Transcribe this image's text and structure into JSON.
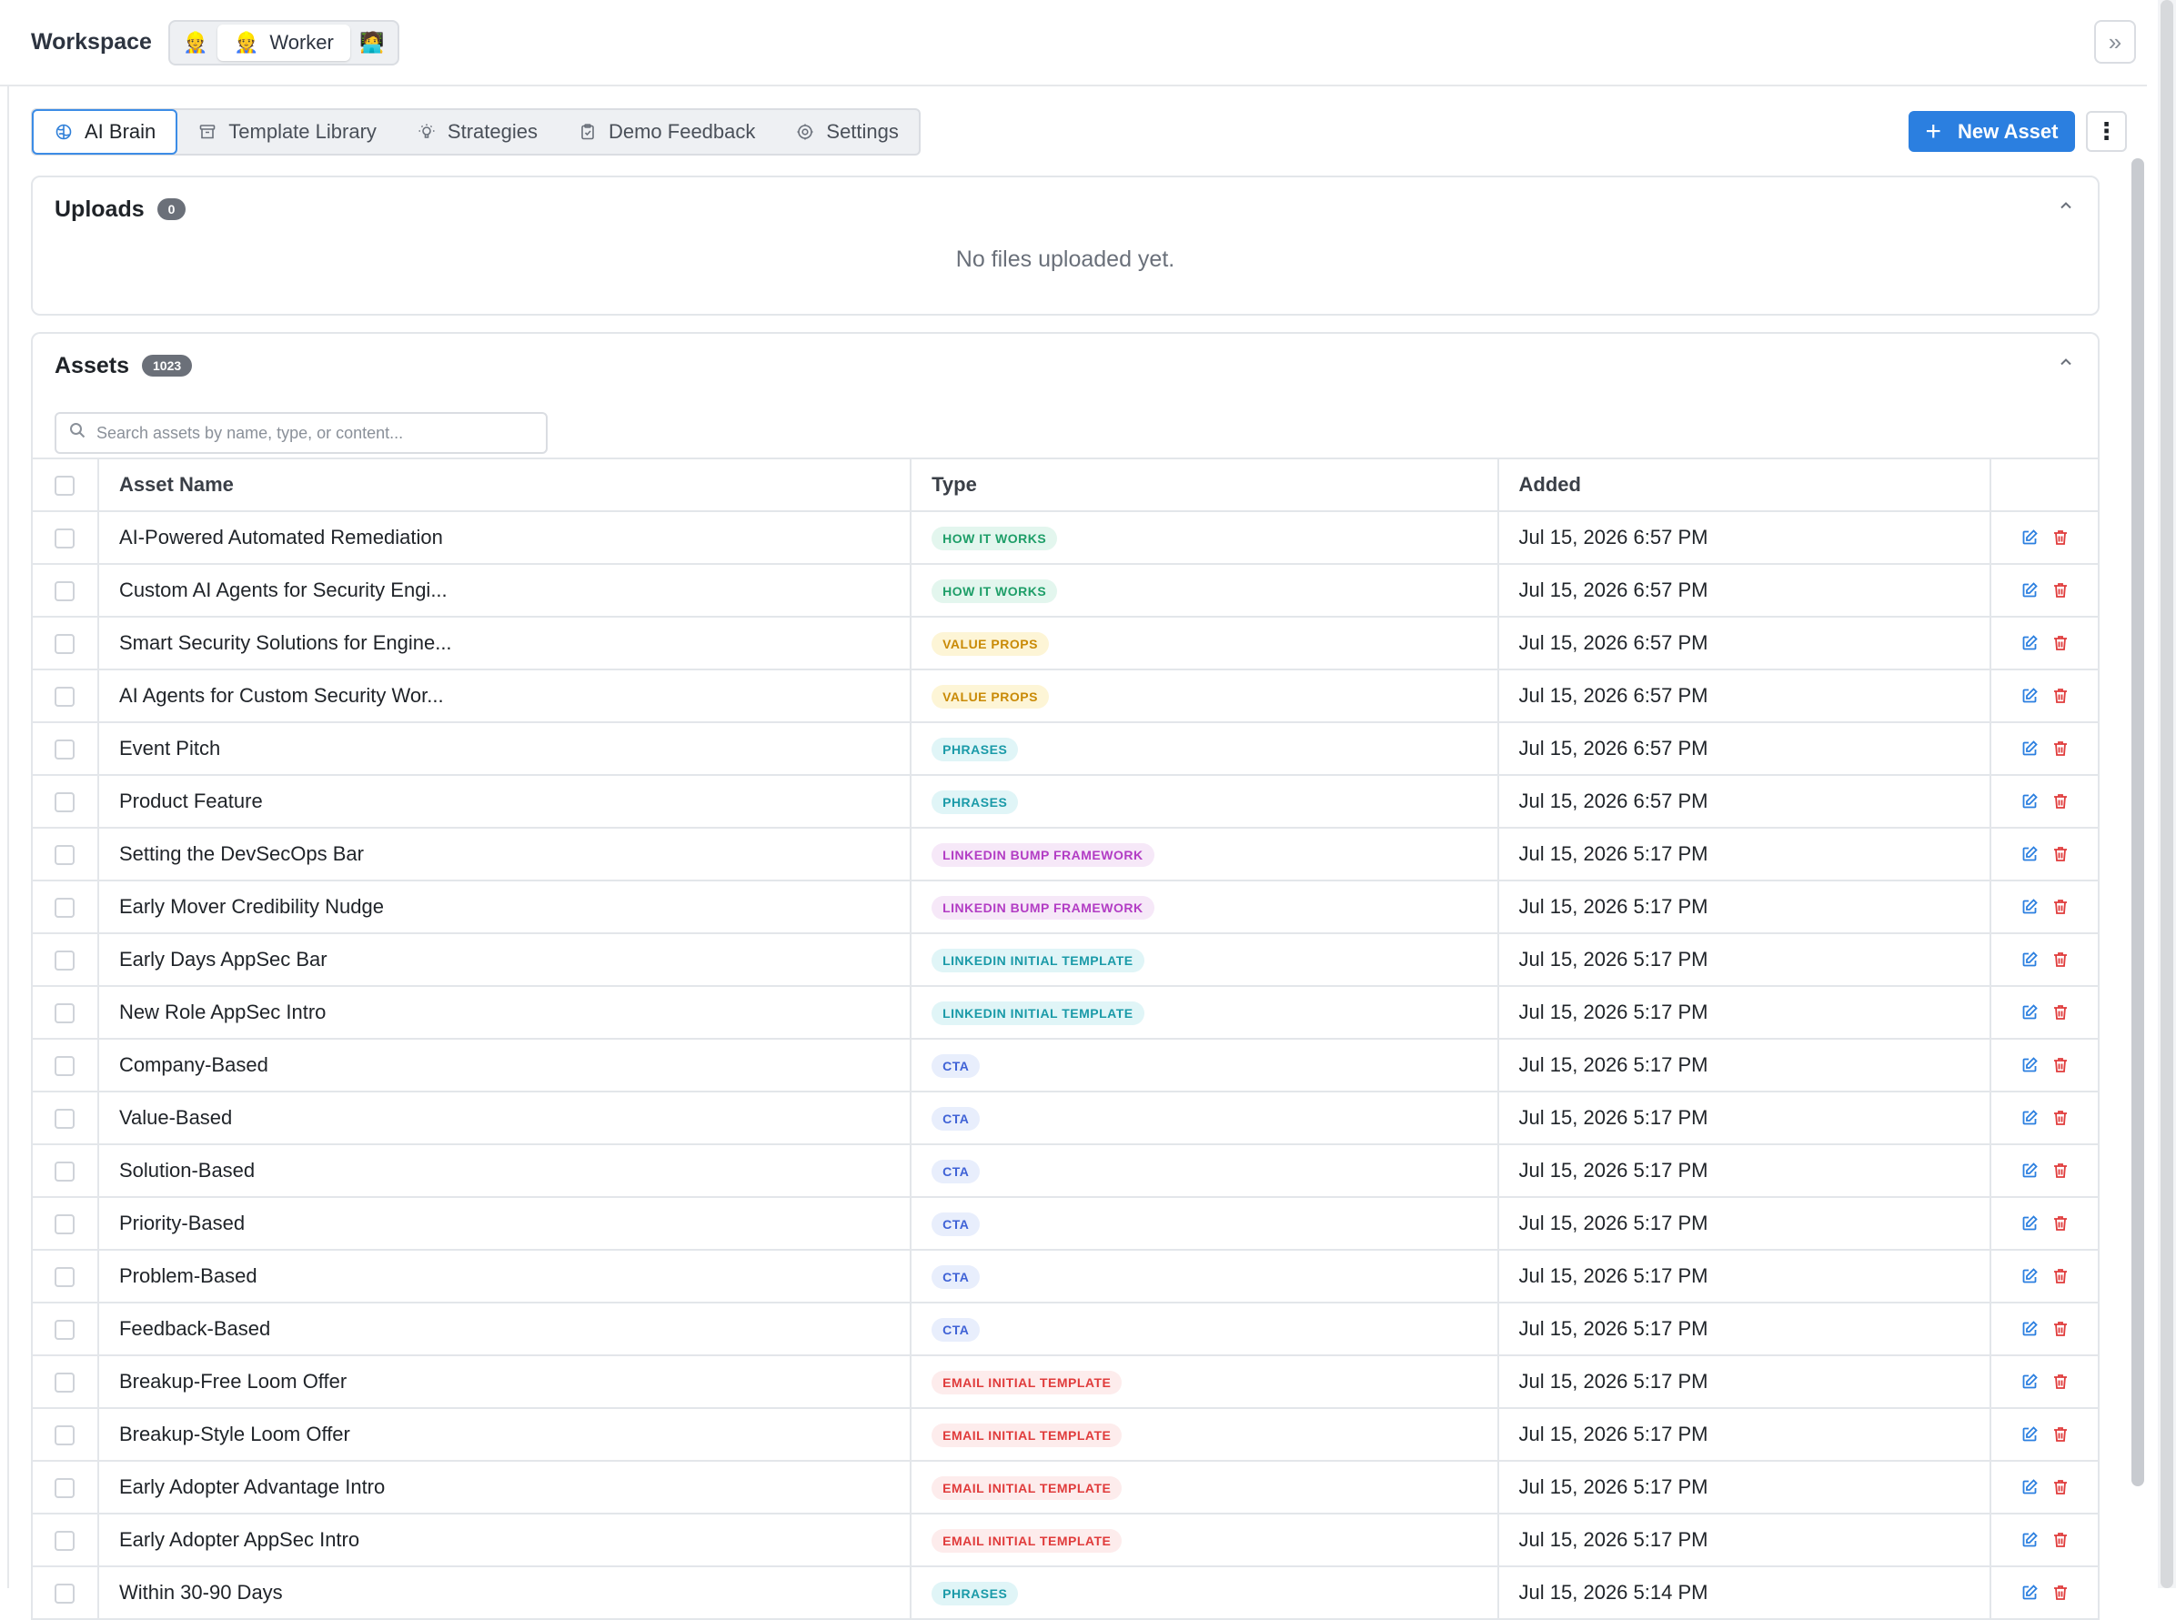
{
  "header": {
    "title": "Workspace",
    "personas": [
      {
        "emoji": "👷",
        "label": "",
        "active": false
      },
      {
        "emoji": "👷",
        "label": "Worker",
        "active": true
      },
      {
        "emoji": "🧑‍💻",
        "label": "",
        "active": false
      }
    ],
    "collapse_label": "»"
  },
  "tabs": [
    {
      "label": "AI Brain",
      "icon": "brain-icon",
      "active": true
    },
    {
      "label": "Template Library",
      "icon": "archive-icon",
      "active": false
    },
    {
      "label": "Strategies",
      "icon": "lightbulb-icon",
      "active": false
    },
    {
      "label": "Demo Feedback",
      "icon": "clipboard-icon",
      "active": false
    },
    {
      "label": "Settings",
      "icon": "gear-icon",
      "active": false
    }
  ],
  "toolbar": {
    "new_asset_label": "New Asset",
    "plus": "+",
    "more": "⋮"
  },
  "uploads": {
    "title": "Uploads",
    "count": "0",
    "empty_text": "No files uploaded yet."
  },
  "assets": {
    "title": "Assets",
    "count": "1023",
    "search_placeholder": "Search assets by name, type, or content...",
    "columns": {
      "name": "Asset Name",
      "type": "Type",
      "added": "Added"
    },
    "type_colors": {
      "HOW IT WORKS": {
        "bg": "#e3f6ee",
        "fg": "#1e9e68"
      },
      "VALUE PROPS": {
        "bg": "#fdf5d6",
        "fg": "#c98a06"
      },
      "PHRASES": {
        "bg": "#e0f5f7",
        "fg": "#1a9aa8"
      },
      "LINKEDIN BUMP FRAMEWORK": {
        "bg": "#f6e8f8",
        "fg": "#b23cc4"
      },
      "LINKEDIN INITIAL TEMPLATE": {
        "bg": "#e0f5f7",
        "fg": "#1a9aa8"
      },
      "CTA": {
        "bg": "#e8eefc",
        "fg": "#3f62d6"
      },
      "EMAIL INITIAL TEMPLATE": {
        "bg": "#fdecec",
        "fg": "#e03b3b"
      }
    },
    "rows": [
      {
        "name": "AI-Powered Automated Remediation",
        "type": "HOW IT WORKS",
        "added": "Jul 15, 2026 6:57 PM"
      },
      {
        "name": "Custom AI Agents for Security Engi...",
        "type": "HOW IT WORKS",
        "added": "Jul 15, 2026 6:57 PM"
      },
      {
        "name": "Smart Security Solutions for Engine...",
        "type": "VALUE PROPS",
        "added": "Jul 15, 2026 6:57 PM"
      },
      {
        "name": "AI Agents for Custom Security Wor...",
        "type": "VALUE PROPS",
        "added": "Jul 15, 2026 6:57 PM"
      },
      {
        "name": "Event Pitch",
        "type": "PHRASES",
        "added": "Jul 15, 2026 6:57 PM"
      },
      {
        "name": "Product Feature",
        "type": "PHRASES",
        "added": "Jul 15, 2026 6:57 PM"
      },
      {
        "name": "Setting the DevSecOps Bar",
        "type": "LINKEDIN BUMP FRAMEWORK",
        "added": "Jul 15, 2026 5:17 PM"
      },
      {
        "name": "Early Mover Credibility Nudge",
        "type": "LINKEDIN BUMP FRAMEWORK",
        "added": "Jul 15, 2026 5:17 PM"
      },
      {
        "name": "Early Days AppSec Bar",
        "type": "LINKEDIN INITIAL TEMPLATE",
        "added": "Jul 15, 2026 5:17 PM"
      },
      {
        "name": "New Role AppSec Intro",
        "type": "LINKEDIN INITIAL TEMPLATE",
        "added": "Jul 15, 2026 5:17 PM"
      },
      {
        "name": "Company-Based",
        "type": "CTA",
        "added": "Jul 15, 2026 5:17 PM"
      },
      {
        "name": "Value-Based",
        "type": "CTA",
        "added": "Jul 15, 2026 5:17 PM"
      },
      {
        "name": "Solution-Based",
        "type": "CTA",
        "added": "Jul 15, 2026 5:17 PM"
      },
      {
        "name": "Priority-Based",
        "type": "CTA",
        "added": "Jul 15, 2026 5:17 PM"
      },
      {
        "name": "Problem-Based",
        "type": "CTA",
        "added": "Jul 15, 2026 5:17 PM"
      },
      {
        "name": "Feedback-Based",
        "type": "CTA",
        "added": "Jul 15, 2026 5:17 PM"
      },
      {
        "name": "Breakup-Free Loom Offer",
        "type": "EMAIL INITIAL TEMPLATE",
        "added": "Jul 15, 2026 5:17 PM"
      },
      {
        "name": "Breakup-Style Loom Offer",
        "type": "EMAIL INITIAL TEMPLATE",
        "added": "Jul 15, 2026 5:17 PM"
      },
      {
        "name": "Early Adopter Advantage Intro",
        "type": "EMAIL INITIAL TEMPLATE",
        "added": "Jul 15, 2026 5:17 PM"
      },
      {
        "name": "Early Adopter AppSec Intro",
        "type": "EMAIL INITIAL TEMPLATE",
        "added": "Jul 15, 2026 5:17 PM"
      },
      {
        "name": "Within 30-90 Days",
        "type": "PHRASES",
        "added": "Jul 15, 2026 5:14 PM"
      }
    ]
  },
  "colors": {
    "accent": "#2b7fe0",
    "edit": "#2b7fe0",
    "delete": "#e03b3b"
  }
}
